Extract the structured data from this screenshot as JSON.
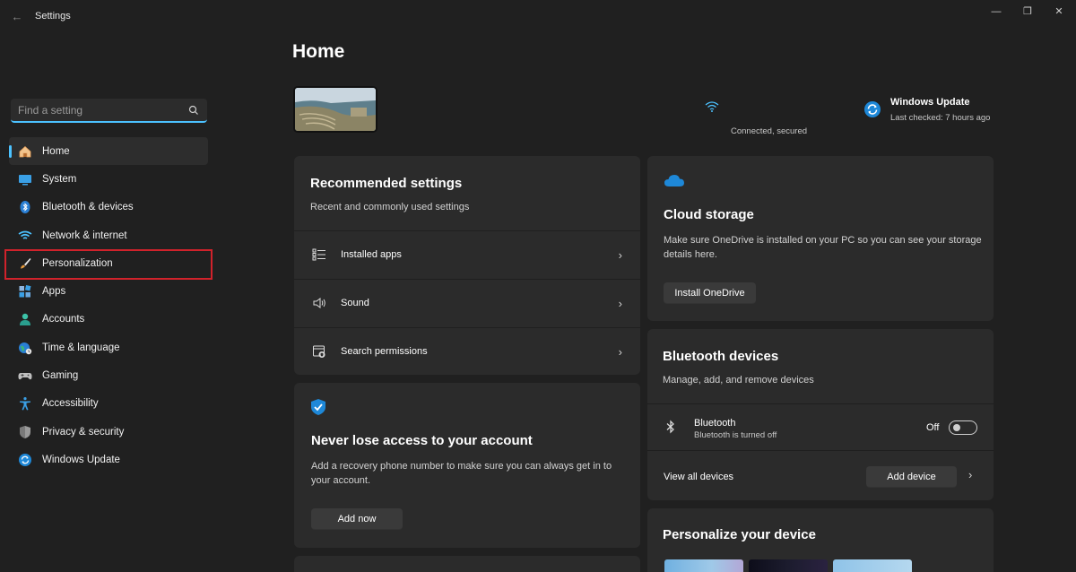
{
  "window": {
    "app_title": "Settings",
    "back_glyph": "←",
    "minimize_glyph": "—",
    "maximize_glyph": "❐",
    "close_glyph": "✕"
  },
  "search": {
    "placeholder": "Find a setting"
  },
  "sidebar": {
    "items": [
      {
        "label": "Home",
        "icon": "home-icon"
      },
      {
        "label": "System",
        "icon": "system-icon"
      },
      {
        "label": "Bluetooth & devices",
        "icon": "bluetooth-icon"
      },
      {
        "label": "Network & internet",
        "icon": "wifi-icon"
      },
      {
        "label": "Personalization",
        "icon": "brush-icon"
      },
      {
        "label": "Apps",
        "icon": "apps-icon"
      },
      {
        "label": "Accounts",
        "icon": "accounts-icon"
      },
      {
        "label": "Time & language",
        "icon": "globe-icon"
      },
      {
        "label": "Gaming",
        "icon": "gamepad-icon"
      },
      {
        "label": "Accessibility",
        "icon": "accessibility-icon"
      },
      {
        "label": "Privacy & security",
        "icon": "shield-icon"
      },
      {
        "label": "Windows Update",
        "icon": "update-icon"
      }
    ],
    "active_index": 0,
    "highlighted_index": 4
  },
  "main": {
    "title": "Home",
    "network_status": "Connected, secured",
    "windows_update": {
      "title": "Windows Update",
      "subtitle": "Last checked: 7 hours ago"
    },
    "recommended": {
      "title": "Recommended settings",
      "subtitle": "Recent and commonly used settings",
      "rows": [
        {
          "label": "Installed apps",
          "icon": "list-icon"
        },
        {
          "label": "Sound",
          "icon": "speaker-icon"
        },
        {
          "label": "Search permissions",
          "icon": "search-permissions-icon"
        }
      ]
    },
    "account": {
      "title": "Never lose access to your account",
      "description": "Add a recovery phone number to make sure you can always get in to your account.",
      "button": "Add now"
    },
    "cloud": {
      "title": "Cloud storage",
      "description": "Make sure OneDrive is installed on your PC so you can see your storage details here.",
      "button": "Install OneDrive"
    },
    "bluetooth": {
      "title": "Bluetooth devices",
      "subtitle": "Manage, add, and remove devices",
      "item_label": "Bluetooth",
      "item_status": "Bluetooth is turned off",
      "toggle_label": "Off",
      "toggle_on": false,
      "view_all": "View all devices",
      "add_button": "Add device"
    },
    "personalize": {
      "title": "Personalize your device"
    }
  },
  "colors": {
    "background": "#202020",
    "card": "#2b2b2b",
    "accent": "#4cc2ff",
    "highlight_box": "#d1222b"
  }
}
